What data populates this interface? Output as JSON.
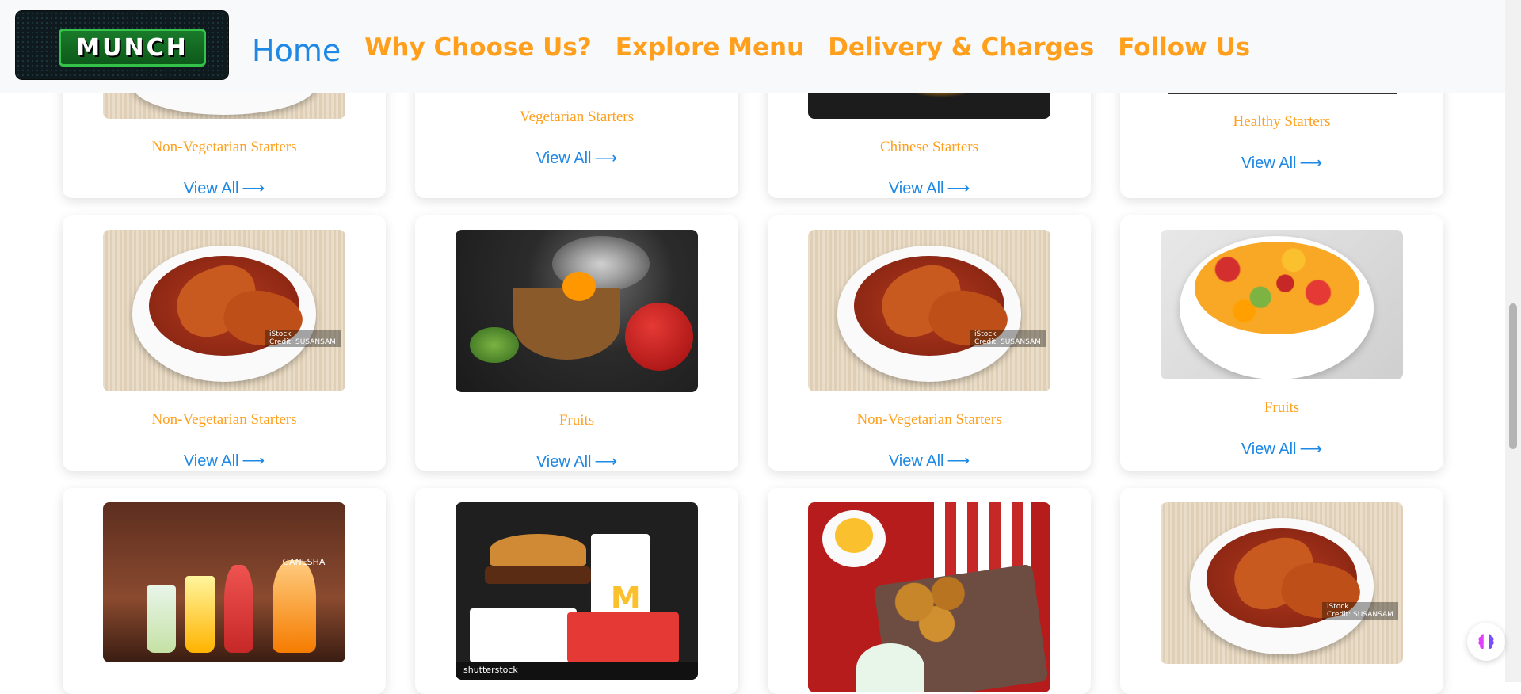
{
  "navbar": {
    "logo_text": "MUNCH",
    "links": [
      "Home",
      "Why Choose Us?",
      "Explore Menu",
      "Delivery & Charges",
      "Follow Us"
    ]
  },
  "cards": {
    "row1": [
      {
        "title": "Non-Vegetarian Starters",
        "link": "View All"
      },
      {
        "title": "Vegetarian Starters",
        "link": "View All"
      },
      {
        "title": "Chinese Starters",
        "link": "View All"
      },
      {
        "title": "Healthy Starters",
        "link": "View All"
      }
    ],
    "row2": [
      {
        "title": "Non-Vegetarian Starters",
        "link": "View All"
      },
      {
        "title": "Fruits",
        "link": "View All"
      },
      {
        "title": "Non-Vegetarian Starters",
        "link": "View All"
      },
      {
        "title": "Fruits",
        "link": "View All"
      }
    ]
  },
  "image_watermarks": {
    "istock": "iStock",
    "istock_credit": "Credit: SUSANSAM",
    "shutterstock": "shutterstock",
    "restaurant": "GANESHA"
  },
  "colors": {
    "nav_orange": "#ff9f1c",
    "link_blue": "#1e88e5",
    "navbar_bg": "#f8f9fa"
  }
}
